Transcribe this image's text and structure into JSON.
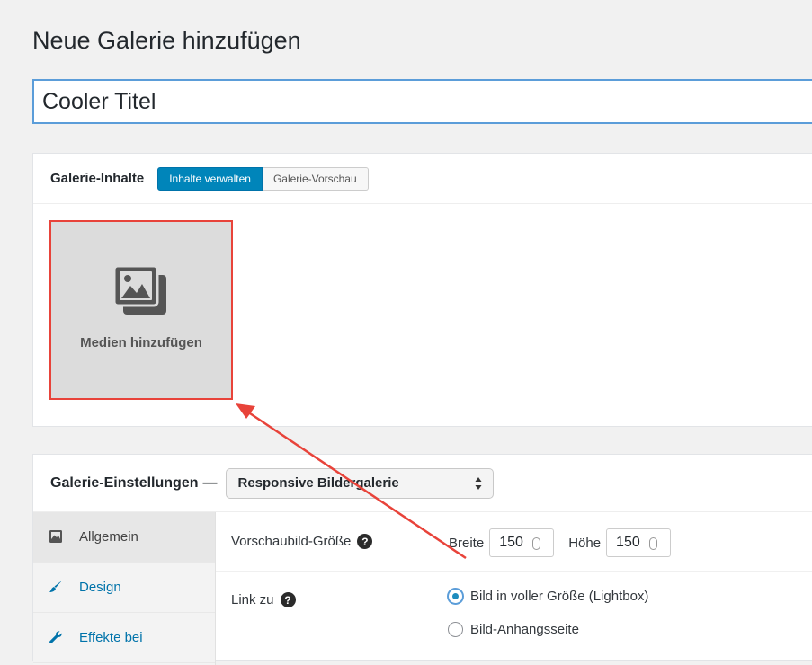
{
  "page": {
    "title": "Neue Galerie hinzufügen",
    "gallery_title_value": "Cooler Titel"
  },
  "content_box": {
    "heading": "Galerie-Inhalte",
    "tabs": [
      {
        "label": "Inhalte verwalten",
        "active": true
      },
      {
        "label": "Galerie-Vorschau",
        "active": false
      }
    ],
    "add_media_label": "Medien hinzufügen",
    "highlight_color": "#e8433a"
  },
  "settings_box": {
    "heading": "Galerie-Einstellungen",
    "separator": "—",
    "gallery_type_selected": "Responsive Bildergalerie",
    "side_tabs": [
      {
        "label": "Allgemein",
        "icon": "image-icon",
        "active": true
      },
      {
        "label": "Design",
        "icon": "paintbrush-icon",
        "active": false
      },
      {
        "label": "Effekte bei",
        "icon": "wrench-icon",
        "active": false
      }
    ],
    "thumbnail": {
      "label": "Vorschaubild-Größe",
      "width_label": "Breite",
      "width_value": "150",
      "height_label": "Höhe",
      "height_value": "150"
    },
    "link": {
      "label": "Link zu",
      "options": [
        {
          "label": "Bild in voller Größe (Lightbox)",
          "checked": true
        },
        {
          "label": "Bild-Anhangsseite",
          "checked": false
        }
      ]
    }
  },
  "colors": {
    "accent": "#0085ba",
    "link": "#0073aa",
    "annotation": "#e8433a"
  }
}
